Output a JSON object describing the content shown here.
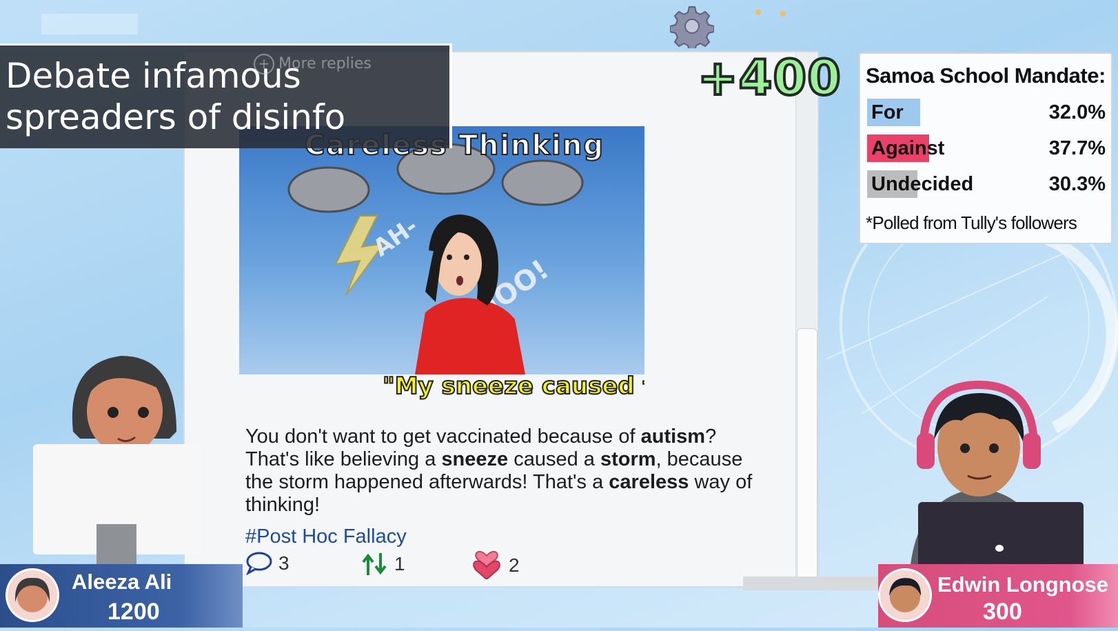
{
  "banner": {
    "title": "Debate infamous spreaders of disinfo",
    "ghost_replies": "More replies",
    "ghost_author": "Aleeza Ali"
  },
  "score_popup": "+400",
  "post": {
    "video_title": "Careless Thinking",
    "video_caption": "\"My sneeze caused th",
    "video_sfx_1": "AH-",
    "video_sfx_2": "CHOO!",
    "body_segments": [
      {
        "text": "You don't want to get vaccinated because of ",
        "bold": false
      },
      {
        "text": "autism",
        "bold": true
      },
      {
        "text": "? That's like believing a ",
        "bold": false
      },
      {
        "text": "sneeze",
        "bold": true
      },
      {
        "text": " caused a ",
        "bold": false
      },
      {
        "text": "storm",
        "bold": true
      },
      {
        "text": ", because the storm happened afterwards! That's a ",
        "bold": false
      },
      {
        "text": "careless",
        "bold": true
      },
      {
        "text": " way of thinking!",
        "bold": false
      }
    ],
    "hashtag": "#Post Hoc Fallacy",
    "stats": {
      "comments": "3",
      "shares": "1",
      "likes": "2"
    }
  },
  "poll": {
    "title": "Samoa School Mandate:",
    "rows": [
      {
        "label": "For",
        "pct": "32.0%",
        "fraction": 0.32,
        "color": "#9fc8ef"
      },
      {
        "label": "Against",
        "pct": "37.7%",
        "fraction": 0.377,
        "color": "#e8416a"
      },
      {
        "label": "Undecided",
        "pct": "30.3%",
        "fraction": 0.303,
        "color": "#bcbcbc"
      }
    ],
    "note": "*Polled from Tully's followers"
  },
  "players": {
    "left": {
      "name": "Aleeza Ali",
      "score": "1200"
    },
    "right": {
      "name": "Edwin Longnose",
      "score": "300"
    }
  },
  "icons": {
    "settings": "gear-icon",
    "comment": "speech-bubble-icon",
    "share": "repost-arrows-icon",
    "like": "hearts-icon"
  }
}
